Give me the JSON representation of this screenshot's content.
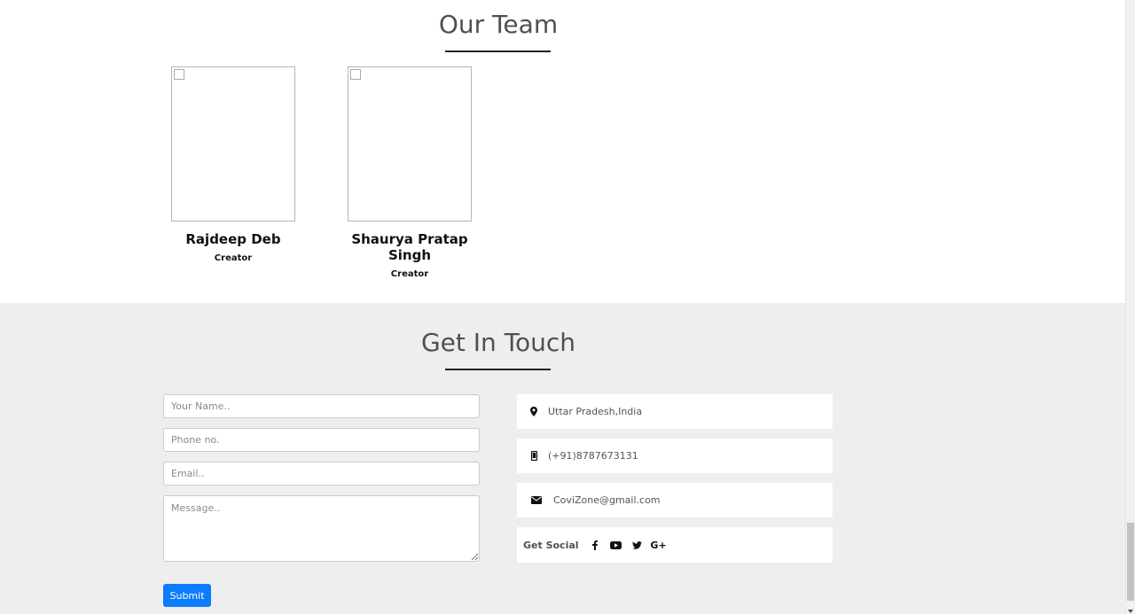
{
  "team": {
    "title": "Our Team",
    "members": [
      {
        "name": "Rajdeep Deb",
        "role": "Creator"
      },
      {
        "name": "Shaurya Pratap Singh",
        "role": "Creator"
      }
    ]
  },
  "contact": {
    "title": "Get In Touch",
    "form": {
      "name_placeholder": "Your Name..",
      "phone_placeholder": "Phone no.",
      "email_placeholder": "Email..",
      "message_placeholder": "Message..",
      "submit_label": "Submit"
    },
    "info": {
      "location": "Uttar Pradesh,India",
      "phone": "(+91)8787673131",
      "email": "CoviZone@gmail.com",
      "social_label": "Get Social",
      "social_icons": [
        "facebook-icon",
        "youtube-icon",
        "twitter-icon",
        "google-plus-icon"
      ],
      "google_plus_glyph": "G+"
    }
  },
  "colors": {
    "accent": "#0b7dfb",
    "contact_bg": "#eeeeee",
    "title": "#505050"
  }
}
